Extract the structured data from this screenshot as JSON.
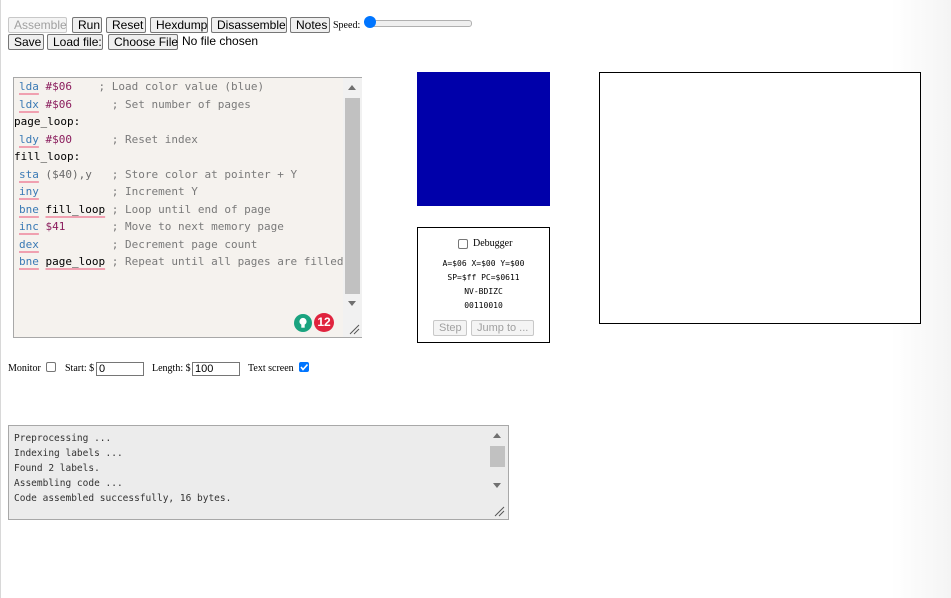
{
  "toolbar": {
    "assemble": "Assemble",
    "run": "Run",
    "reset": "Reset",
    "hexdump": "Hexdump",
    "disassemble": "Disassemble",
    "notes": "Notes",
    "speed_label": "Speed:",
    "speed_level": 0.0,
    "save": "Save",
    "load_file": "Load file:",
    "choose_file": "Choose File",
    "no_file": "No file chosen"
  },
  "editor": {
    "lines": [
      {
        "op": "lda",
        "arg": "#$06",
        "pad": "    ",
        "cmt": "; Load color value (blue)"
      },
      {
        "op": "ldx",
        "arg": "#$06",
        "pad": "      ",
        "cmt": "; Set number of pages"
      },
      {
        "label": "page_loop:"
      },
      {
        "op": "ldy",
        "arg": "#$00",
        "pad": "      ",
        "cmt": "; Reset index"
      },
      {
        "label": "fill_loop:"
      },
      {
        "op": "sta",
        "arg": "($40),y",
        "pad": "   ",
        "cmt": "; Store color at pointer + Y"
      },
      {
        "op": "iny",
        "arg": "",
        "pad": "          ",
        "cmt": "; Increment Y"
      },
      {
        "op": "bne",
        "arg": "fill_loop",
        "pad": " ",
        "cmt": "; Loop until end of page"
      },
      {
        "op": "inc",
        "arg": "$41",
        "pad": "       ",
        "cmt": "; Move to next memory page"
      },
      {
        "op": "dex",
        "arg": "",
        "pad": "          ",
        "cmt": "; Decrement page count"
      },
      {
        "op": "bne",
        "arg": "page_loop",
        "pad": " ",
        "cmt": "; Repeat until all pages are filled"
      }
    ],
    "issue_count": "12",
    "bulb_glyph": "💡"
  },
  "screen": {
    "color": "#0000aa"
  },
  "debugger": {
    "label": "Debugger",
    "enabled": false,
    "regs1": "A=$06 X=$00 Y=$00",
    "regs2": "SP=$ff PC=$0611",
    "flags_header": "NV-BDIZC",
    "flags_bits": "00110010",
    "step": "Step",
    "jump_to": "Jump to ..."
  },
  "monitor": {
    "label": "Monitor",
    "enabled": false,
    "start_label": "Start: $",
    "start_value": "0",
    "length_label": "Length: $",
    "length_value": "100",
    "text_screen_label": "Text screen",
    "text_screen_enabled": true
  },
  "output": {
    "lines": [
      "Preprocessing ...",
      "Indexing labels ...",
      "Found 2 labels.",
      "Assembling code ...",
      "Code assembled successfully, 16 bytes."
    ]
  },
  "colors": {
    "accent": "#0075ff",
    "badge_red": "#e0243e",
    "badge_green": "#1aa37f",
    "opcode": "#3a7ab5",
    "argument": "#8a1c5c",
    "comment": "#7a7a7a"
  }
}
